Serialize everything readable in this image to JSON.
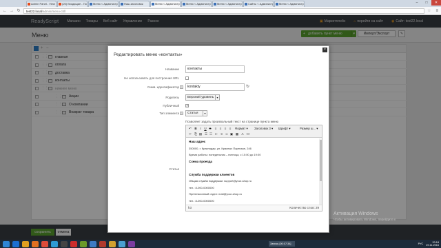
{
  "browser": {
    "tabs": [
      {
        "label": "Admin Panel - View Ticket",
        "active": false
      },
      {
        "label": "(25) Входящие - Почта М...",
        "active": false
      },
      {
        "label": "Меню < Административная п...",
        "active": false
      },
      {
        "label": "Наш заголовок",
        "active": false
      },
      {
        "label": "Меню < Административная п...",
        "active": true
      },
      {
        "label": "Меню < Административная п...",
        "active": false
      },
      {
        "label": "Меню < Административная п...",
        "active": false
      },
      {
        "label": "Сайты < Административная п...",
        "active": false
      },
      {
        "label": "Меню < Административная п...",
        "active": false
      }
    ],
    "url_host": "test22.local",
    "url_path": "/admin/menu-ctrl/",
    "back_icon": "back-arrow-icon",
    "window_controls": [
      "–",
      "□",
      "✕"
    ]
  },
  "topbar": {
    "logo": "ReadyScript",
    "nav": [
      "Магазин",
      "Товары",
      "Веб сайт",
      "Управление",
      "Разное"
    ],
    "right": [
      "Маркетплейс",
      "перейти на сайт",
      "Сайт: test22.local"
    ]
  },
  "page": {
    "title": "Меню",
    "add_button": "добавить пункт меню",
    "import_export": "Импорт/Экспорт"
  },
  "tree": {
    "rows": [
      {
        "label": "главная",
        "level": 0,
        "muted": false
      },
      {
        "label": "оплата",
        "level": 0,
        "muted": false
      },
      {
        "label": "доставка",
        "level": 0,
        "muted": false
      },
      {
        "label": "контакты",
        "level": 0,
        "muted": false
      },
      {
        "label": "нижнее меню",
        "level": 0,
        "muted": true
      },
      {
        "label": "Акции",
        "level": 1,
        "muted": false
      },
      {
        "label": "О компании",
        "level": 1,
        "muted": false
      },
      {
        "label": "Возврат товара",
        "level": 1,
        "muted": false
      }
    ]
  },
  "footer": {
    "save": "сохранить",
    "cancel": "отмена"
  },
  "modal": {
    "title": "Редактировать меню «контакты»",
    "close": "×",
    "fields": {
      "name_label": "Название",
      "name_value": "контакты",
      "hide_label": "Не использовать для построения URL",
      "alias_label": "Симв. идентификатор",
      "alias_value": "kontakty",
      "parent_label": "Родитель",
      "parent_value": "Верхний уровень",
      "public_label": "Публичный",
      "public_checked": "✓",
      "type_label": "Тип элемента",
      "type_value": "Статья",
      "type_hint": "Позволяет задать произвольный текст на странице пункта меню",
      "article_label": "Статья"
    },
    "editor": {
      "format": "Формат",
      "heading": "Заголовок 3",
      "font": "Шрифт",
      "size": "Размер ш...",
      "content": [
        {
          "text": "Наш адрес",
          "bold": true
        },
        {
          "text": "350000, г. Краснодар, ул. Красных Партизан, 246",
          "bold": false
        },
        {
          "text": "Время работы: понедельник – пятница, с 10:00 до 19:00",
          "bold": false
        },
        {
          "text": "Схема проезда",
          "bold": true
        },
        {
          "text": "",
          "bold": false
        },
        {
          "text": "Служба поддержки клиентов",
          "bold": true
        },
        {
          "text": "Общая служба поддержки: support@your-shop.ru",
          "bold": false
        },
        {
          "text": "тел.: 8-000-0000000",
          "bold": false
        },
        {
          "text": "Претензионный отдел: mail@your-shop.ru",
          "bold": false
        },
        {
          "text": "тел.: 8-000-0000000",
          "bold": false
        }
      ],
      "path": "h3",
      "word_count": "Количество слов: 29"
    }
  },
  "watermark": {
    "line1": "Активация Windows",
    "line2": "Чтобы активировать Windows, перейдите к"
  },
  "taskbar": {
    "task_label": "Запись [00:07:34]",
    "lang": "РУС",
    "time": "20:18",
    "date": "29.11.2016"
  }
}
